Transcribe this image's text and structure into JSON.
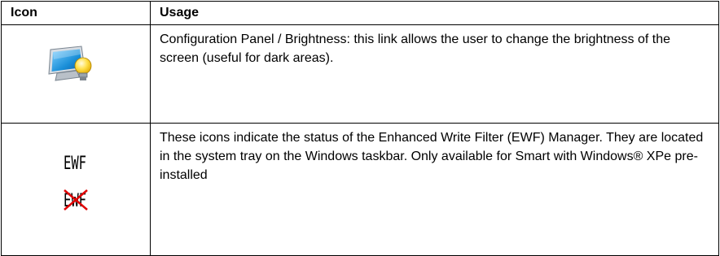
{
  "table": {
    "headers": {
      "icon": "Icon",
      "usage": "Usage"
    },
    "rows": [
      {
        "icon": "brightness-monitor-icon",
        "usage": "Configuration Panel / Brightness: this link allows the user to change the brightness of the screen (useful for dark areas)."
      },
      {
        "icon": "ewf-status-icons",
        "icon_text": "EWF",
        "usage": "These icons indicate the status of the Enhanced Write Filter (EWF) Manager. They are located in the system tray on the Windows taskbar. Only available for Smart with Windows® XPe pre-installed"
      }
    ]
  },
  "colors": {
    "border": "#000000",
    "screen": "#1a8fd8",
    "bulb": "#ffe04a",
    "cross": "#e00000"
  }
}
